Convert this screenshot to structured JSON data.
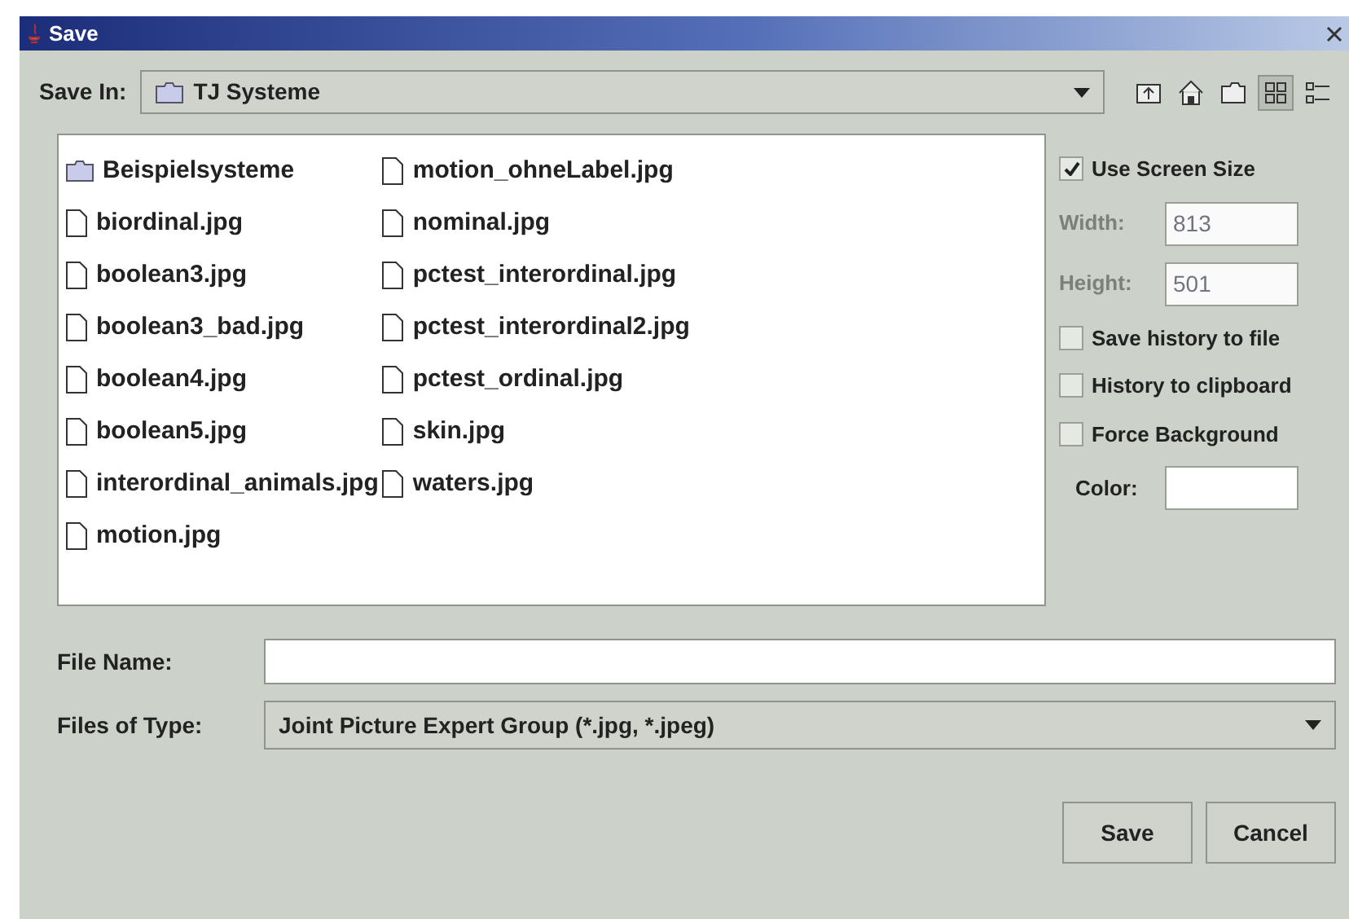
{
  "window": {
    "title": "Save"
  },
  "save_in": {
    "label": "Save In:",
    "value": "TJ Systeme"
  },
  "toolbar": [
    {
      "kind": "up-folder"
    },
    {
      "kind": "home"
    },
    {
      "kind": "new-folder"
    },
    {
      "kind": "list-view",
      "selected": true
    },
    {
      "kind": "details-view",
      "selected": false
    }
  ],
  "files": [
    {
      "kind": "folder",
      "name": "Beispielsysteme"
    },
    {
      "kind": "file",
      "name": "biordinal.jpg"
    },
    {
      "kind": "file",
      "name": "boolean3.jpg"
    },
    {
      "kind": "file",
      "name": "boolean3_bad.jpg"
    },
    {
      "kind": "file",
      "name": "boolean4.jpg"
    },
    {
      "kind": "file",
      "name": "boolean5.jpg"
    },
    {
      "kind": "file",
      "name": "interordinal_animals.jpg"
    },
    {
      "kind": "file",
      "name": "motion.jpg"
    },
    {
      "kind": "file",
      "name": "motion_ohneLabel.jpg"
    },
    {
      "kind": "file",
      "name": "nominal.jpg"
    },
    {
      "kind": "file",
      "name": "pctest_interordinal.jpg"
    },
    {
      "kind": "file",
      "name": "pctest_interordinal2.jpg"
    },
    {
      "kind": "file",
      "name": "pctest_ordinal.jpg"
    },
    {
      "kind": "file",
      "name": "skin.jpg"
    },
    {
      "kind": "file",
      "name": "waters.jpg"
    }
  ],
  "options": [
    {
      "kind": "checkbox",
      "label": "Use Screen Size",
      "checked": true
    },
    {
      "kind": "field",
      "label": "Width:",
      "value": "813",
      "disabled": true
    },
    {
      "kind": "field",
      "label": "Height:",
      "value": "501",
      "disabled": true
    },
    {
      "kind": "checkbox",
      "label": "Save history to file",
      "checked": false
    },
    {
      "kind": "checkbox",
      "label": "History to clipboard",
      "checked": false
    },
    {
      "kind": "checkbox",
      "label": "Force Background",
      "checked": false
    },
    {
      "kind": "field",
      "label": "Color:",
      "disabled": false
    }
  ],
  "file_name": {
    "label": "File Name:"
  },
  "file_type": {
    "label": "Files of Type:",
    "value": "Joint Picture Expert Group (*.jpg, *.jpeg)"
  },
  "buttons": [
    "Save",
    "Cancel"
  ]
}
